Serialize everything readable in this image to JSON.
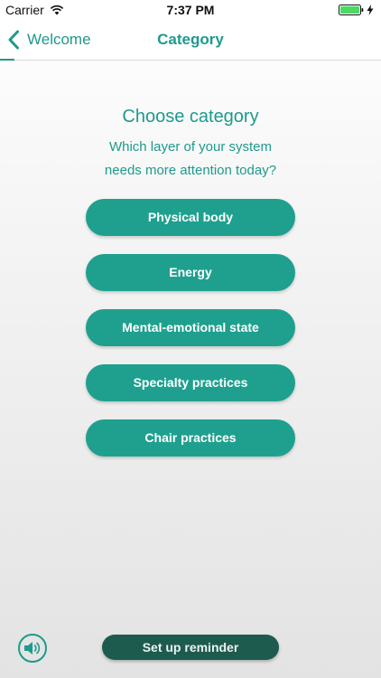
{
  "status_bar": {
    "carrier": "Carrier",
    "time": "7:37 PM",
    "wifi_icon": "wifi-icon",
    "battery_icon": "battery-icon",
    "battery_level": 1.0,
    "charging_icon": "bolt-icon"
  },
  "nav": {
    "back_label": "Welcome",
    "back_icon": "chevron-left-icon",
    "title": "Category"
  },
  "content": {
    "heading": "Choose category",
    "subheading_lines": [
      "Which layer of your system",
      "needs more attention today?"
    ]
  },
  "categories": [
    {
      "label": "Physical body"
    },
    {
      "label": "Energy"
    },
    {
      "label": "Mental-emotional state"
    },
    {
      "label": "Specialty practices"
    },
    {
      "label": "Chair practices"
    }
  ],
  "footer": {
    "sound_icon": "speaker-icon",
    "reminder_label": "Set up reminder"
  },
  "colors": {
    "accent": "#1e9a8c",
    "button": "#1fa08f",
    "reminder_button": "#1e5b4f",
    "battery": "#4cd964"
  }
}
